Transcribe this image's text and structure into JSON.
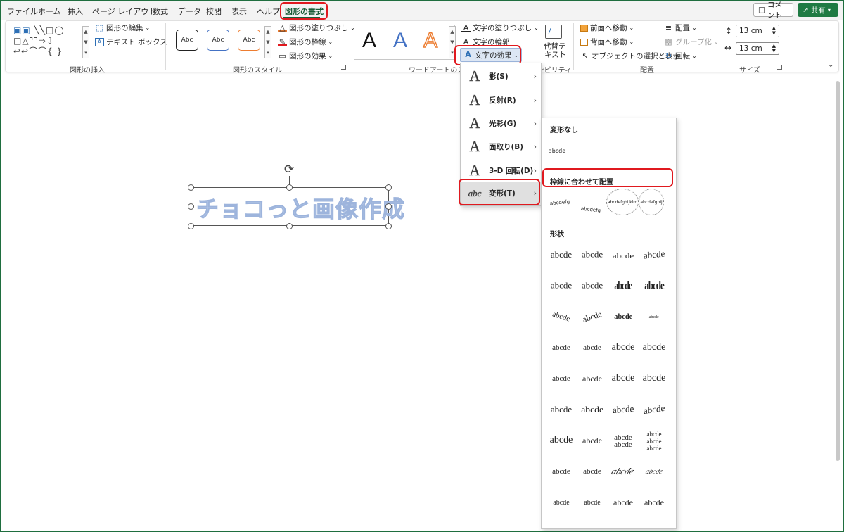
{
  "menu_tabs": [
    "ファイル",
    "ホーム",
    "挿入",
    "ページ レイアウト",
    "数式",
    "データ",
    "校閲",
    "表示",
    "ヘルプ",
    "図形の書式"
  ],
  "active_tab": "図形の書式",
  "top_buttons": {
    "comment": "コメント",
    "share": "共有"
  },
  "ribbon": {
    "insert_shapes": {
      "label": "図形の挿入",
      "edit_shape": "図形の編集",
      "text_box": "テキスト ボックス"
    },
    "shape_styles": {
      "label": "図形のスタイル",
      "presets": [
        "Abc",
        "Abc",
        "Abc"
      ],
      "fill": "図形の塗りつぶし",
      "outline": "図形の枠線",
      "effects": "図形の効果"
    },
    "wordart_styles": {
      "label": "ワードアートのスタイル",
      "letters": [
        "A",
        "A",
        "A"
      ],
      "text_fill": "文字の塗りつぶし",
      "text_outline": "文字の輪郭",
      "text_effects": "文字の効果"
    },
    "accessibility": {
      "label": "アクセシビリティ",
      "alt_text_line1": "代替テ",
      "alt_text_line2": "キスト"
    },
    "arrange": {
      "label": "配置",
      "bring_forward": "前面へ移動",
      "send_backward": "背面へ移動",
      "selection_pane": "オブジェクトの選択と表示",
      "align": "配置",
      "group": "グループ化",
      "rotate": "回転"
    },
    "size": {
      "label": "サイズ",
      "height": "13 cm",
      "width": "13 cm"
    }
  },
  "canvas": {
    "wordart_text": "チョコっと画像作成"
  },
  "text_effects_menu": [
    {
      "label": "影(S)",
      "icon": "A"
    },
    {
      "label": "反射(R)",
      "icon": "A"
    },
    {
      "label": "光彩(G)",
      "icon": "A"
    },
    {
      "label": "面取り(B)",
      "icon": "A"
    },
    {
      "label": "3-D 回転(D)",
      "icon": "A"
    },
    {
      "label": "変形(T)",
      "icon": "abc"
    }
  ],
  "transform_gallery": {
    "no_transform_header": "変形なし",
    "no_transform_sample": "abcde",
    "follow_path_header": "枠線に合わせて配置",
    "follow_path_samples": [
      "abcdefg",
      "abcdefg",
      "abcdefghijklm",
      "abcdefghij"
    ],
    "warp_header": "形状",
    "sample_text": "abcde",
    "footer_dots": "....."
  },
  "colors": {
    "accent_green": "#185c37",
    "highlight_red": "#e0191f",
    "wordart_blue": "#b4c7e7",
    "wordart_blue_ribbon": "#4472c4",
    "wordart_orange": "#ed7d31"
  }
}
